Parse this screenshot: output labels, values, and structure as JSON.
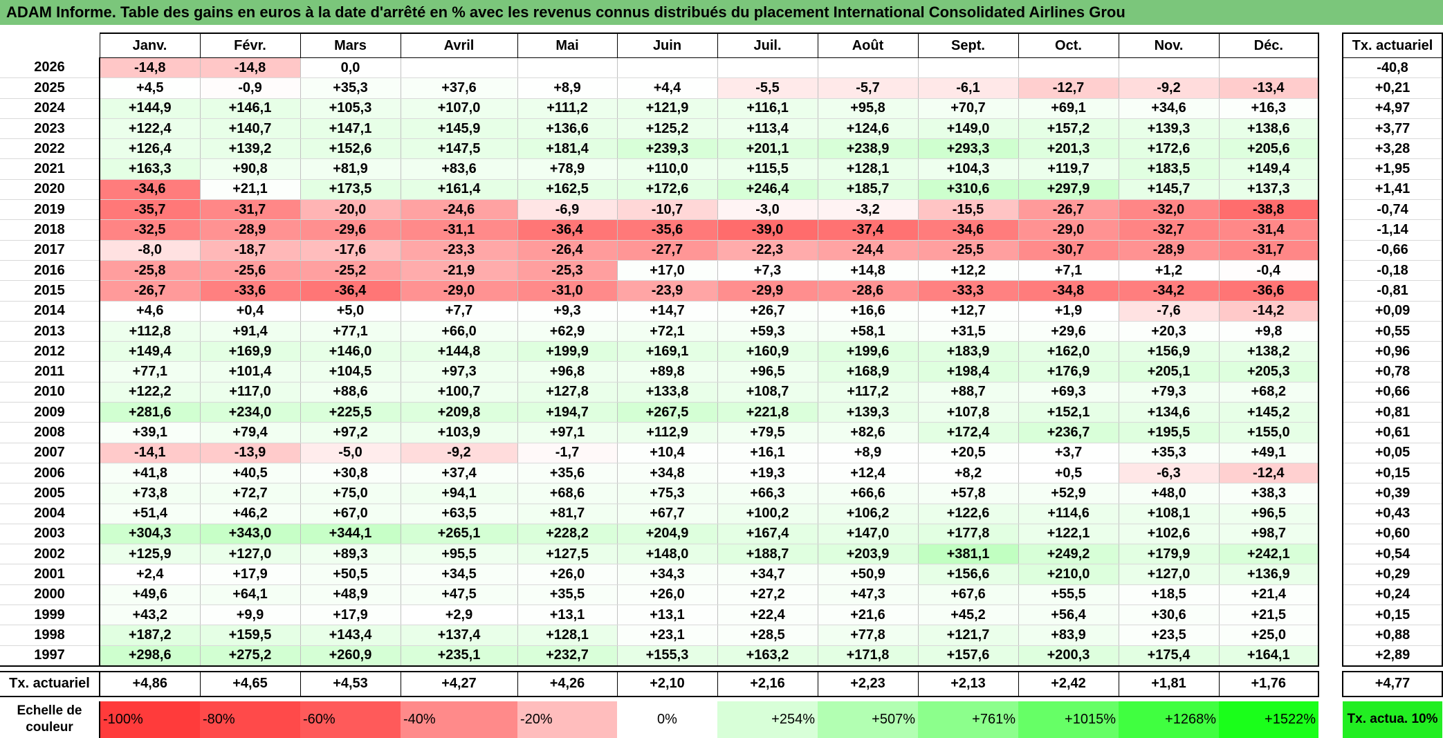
{
  "title": "ADAM Informe. Table des gains en euros à la date d'arrêté en % avec les revenus connus distribués du placement International Consolidated Airlines Grou",
  "months": [
    "Janv.",
    "Févr.",
    "Mars",
    "Avril",
    "Mai",
    "Juin",
    "Juil.",
    "Août",
    "Sept.",
    "Oct.",
    "Nov.",
    "Déc."
  ],
  "act_header": "Tx. actuariel",
  "rows": [
    {
      "year": "2026",
      "values": [
        "-14,8",
        "-14,8",
        "0,0",
        "",
        "",
        "",
        "",
        "",
        "",
        "",
        "",
        ""
      ],
      "act": "-40,8"
    },
    {
      "year": "2025",
      "values": [
        "+4,5",
        "-0,9",
        "+35,3",
        "+37,6",
        "+8,9",
        "+4,4",
        "-5,5",
        "-5,7",
        "-6,1",
        "-12,7",
        "-9,2",
        "-13,4"
      ],
      "act": "+0,21"
    },
    {
      "year": "2024",
      "values": [
        "+144,9",
        "+146,1",
        "+105,3",
        "+107,0",
        "+111,2",
        "+121,9",
        "+116,1",
        "+95,8",
        "+70,7",
        "+69,1",
        "+34,6",
        "+16,3"
      ],
      "act": "+4,97"
    },
    {
      "year": "2023",
      "values": [
        "+122,4",
        "+140,7",
        "+147,1",
        "+145,9",
        "+136,6",
        "+125,2",
        "+113,4",
        "+124,6",
        "+149,0",
        "+157,2",
        "+139,3",
        "+138,6"
      ],
      "act": "+3,77"
    },
    {
      "year": "2022",
      "values": [
        "+126,4",
        "+139,2",
        "+152,6",
        "+147,5",
        "+181,4",
        "+239,3",
        "+201,1",
        "+238,9",
        "+293,3",
        "+201,3",
        "+172,6",
        "+205,6"
      ],
      "act": "+3,28"
    },
    {
      "year": "2021",
      "values": [
        "+163,3",
        "+90,8",
        "+81,9",
        "+83,6",
        "+78,9",
        "+110,0",
        "+115,5",
        "+128,1",
        "+104,3",
        "+119,7",
        "+183,5",
        "+149,4"
      ],
      "act": "+1,95"
    },
    {
      "year": "2020",
      "values": [
        "-34,6",
        "+21,1",
        "+173,5",
        "+161,4",
        "+162,5",
        "+172,6",
        "+246,4",
        "+185,7",
        "+310,6",
        "+297,9",
        "+145,7",
        "+137,3"
      ],
      "act": "+1,41"
    },
    {
      "year": "2019",
      "values": [
        "-35,7",
        "-31,7",
        "-20,0",
        "-24,6",
        "-6,9",
        "-10,7",
        "-3,0",
        "-3,2",
        "-15,5",
        "-26,7",
        "-32,0",
        "-38,8"
      ],
      "act": "-0,74"
    },
    {
      "year": "2018",
      "values": [
        "-32,5",
        "-28,9",
        "-29,6",
        "-31,1",
        "-36,4",
        "-35,6",
        "-39,0",
        "-37,4",
        "-34,6",
        "-29,0",
        "-32,7",
        "-31,4"
      ],
      "act": "-1,14"
    },
    {
      "year": "2017",
      "values": [
        "-8,0",
        "-18,7",
        "-17,6",
        "-23,3",
        "-26,4",
        "-27,7",
        "-22,3",
        "-24,4",
        "-25,5",
        "-30,7",
        "-28,9",
        "-31,7"
      ],
      "act": "-0,66"
    },
    {
      "year": "2016",
      "values": [
        "-25,8",
        "-25,6",
        "-25,2",
        "-21,9",
        "-25,3",
        "+17,0",
        "+7,3",
        "+14,8",
        "+12,2",
        "+7,1",
        "+1,2",
        "-0,4"
      ],
      "act": "-0,18"
    },
    {
      "year": "2015",
      "values": [
        "-26,7",
        "-33,6",
        "-36,4",
        "-29,0",
        "-31,0",
        "-23,9",
        "-29,9",
        "-28,6",
        "-33,3",
        "-34,8",
        "-34,2",
        "-36,6"
      ],
      "act": "-0,81"
    },
    {
      "year": "2014",
      "values": [
        "+4,6",
        "+0,4",
        "+5,0",
        "+7,7",
        "+9,3",
        "+14,7",
        "+26,7",
        "+16,6",
        "+12,7",
        "+1,9",
        "-7,6",
        "-14,2"
      ],
      "act": "+0,09"
    },
    {
      "year": "2013",
      "values": [
        "+112,8",
        "+91,4",
        "+77,1",
        "+66,0",
        "+62,9",
        "+72,1",
        "+59,3",
        "+58,1",
        "+31,5",
        "+29,6",
        "+20,3",
        "+9,8"
      ],
      "act": "+0,55"
    },
    {
      "year": "2012",
      "values": [
        "+149,4",
        "+169,9",
        "+146,0",
        "+144,8",
        "+199,9",
        "+169,1",
        "+160,9",
        "+199,6",
        "+183,9",
        "+162,0",
        "+156,9",
        "+138,2"
      ],
      "act": "+0,96"
    },
    {
      "year": "2011",
      "values": [
        "+77,1",
        "+101,4",
        "+104,5",
        "+97,3",
        "+96,8",
        "+89,8",
        "+96,5",
        "+168,9",
        "+198,4",
        "+176,9",
        "+205,1",
        "+205,3"
      ],
      "act": "+0,78"
    },
    {
      "year": "2010",
      "values": [
        "+122,2",
        "+117,0",
        "+88,6",
        "+100,7",
        "+127,8",
        "+133,8",
        "+108,7",
        "+117,2",
        "+88,7",
        "+69,3",
        "+79,3",
        "+68,2"
      ],
      "act": "+0,66"
    },
    {
      "year": "2009",
      "values": [
        "+281,6",
        "+234,0",
        "+225,5",
        "+209,8",
        "+194,7",
        "+267,5",
        "+221,8",
        "+139,3",
        "+107,8",
        "+152,1",
        "+134,6",
        "+145,2"
      ],
      "act": "+0,81"
    },
    {
      "year": "2008",
      "values": [
        "+39,1",
        "+79,4",
        "+97,2",
        "+103,9",
        "+97,1",
        "+112,9",
        "+79,5",
        "+82,6",
        "+172,4",
        "+236,7",
        "+195,5",
        "+155,0"
      ],
      "act": "+0,61"
    },
    {
      "year": "2007",
      "values": [
        "-14,1",
        "-13,9",
        "-5,0",
        "-9,2",
        "-1,7",
        "+10,4",
        "+16,1",
        "+8,9",
        "+20,5",
        "+3,7",
        "+35,3",
        "+49,1"
      ],
      "act": "+0,05"
    },
    {
      "year": "2006",
      "values": [
        "+41,8",
        "+40,5",
        "+30,8",
        "+37,4",
        "+35,6",
        "+34,8",
        "+19,3",
        "+12,4",
        "+8,2",
        "+0,5",
        "-6,3",
        "-12,4"
      ],
      "act": "+0,15"
    },
    {
      "year": "2005",
      "values": [
        "+73,8",
        "+72,7",
        "+75,0",
        "+94,1",
        "+68,6",
        "+75,3",
        "+66,3",
        "+66,6",
        "+57,8",
        "+52,9",
        "+48,0",
        "+38,3"
      ],
      "act": "+0,39"
    },
    {
      "year": "2004",
      "values": [
        "+51,4",
        "+46,2",
        "+67,0",
        "+63,5",
        "+81,7",
        "+67,7",
        "+100,2",
        "+106,2",
        "+122,6",
        "+114,6",
        "+108,1",
        "+96,5"
      ],
      "act": "+0,43"
    },
    {
      "year": "2003",
      "values": [
        "+304,3",
        "+343,0",
        "+344,1",
        "+265,1",
        "+228,2",
        "+204,9",
        "+167,4",
        "+147,0",
        "+177,8",
        "+122,1",
        "+102,6",
        "+98,7"
      ],
      "act": "+0,60"
    },
    {
      "year": "2002",
      "values": [
        "+125,9",
        "+127,0",
        "+89,3",
        "+95,5",
        "+127,5",
        "+148,0",
        "+188,7",
        "+203,9",
        "+381,1",
        "+249,2",
        "+179,9",
        "+242,1"
      ],
      "act": "+0,54"
    },
    {
      "year": "2001",
      "values": [
        "+2,4",
        "+17,9",
        "+50,5",
        "+34,5",
        "+26,0",
        "+34,3",
        "+34,7",
        "+50,9",
        "+156,6",
        "+210,0",
        "+127,0",
        "+136,9"
      ],
      "act": "+0,29"
    },
    {
      "year": "2000",
      "values": [
        "+49,6",
        "+64,1",
        "+48,9",
        "+47,5",
        "+35,5",
        "+26,0",
        "+27,2",
        "+47,3",
        "+67,6",
        "+55,5",
        "+18,5",
        "+21,4"
      ],
      "act": "+0,24"
    },
    {
      "year": "1999",
      "values": [
        "+43,2",
        "+9,9",
        "+17,9",
        "+2,9",
        "+13,1",
        "+13,1",
        "+22,4",
        "+21,6",
        "+45,2",
        "+56,4",
        "+30,6",
        "+21,5"
      ],
      "act": "+0,15"
    },
    {
      "year": "1998",
      "values": [
        "+187,2",
        "+159,5",
        "+143,4",
        "+137,4",
        "+128,1",
        "+23,1",
        "+28,5",
        "+77,8",
        "+121,7",
        "+83,9",
        "+23,5",
        "+25,0"
      ],
      "act": "+0,88"
    },
    {
      "year": "1997",
      "values": [
        "+298,6",
        "+275,2",
        "+260,9",
        "+235,1",
        "+232,7",
        "+155,3",
        "+163,2",
        "+171,8",
        "+157,6",
        "+200,3",
        "+175,4",
        "+164,1"
      ],
      "act": "+2,89"
    }
  ],
  "act_row": {
    "label": "Tx. actuariel",
    "values": [
      "+4,86",
      "+4,65",
      "+4,53",
      "+4,27",
      "+4,26",
      "+2,10",
      "+2,16",
      "+2,23",
      "+2,13",
      "+2,42",
      "+1,81",
      "+1,76"
    ],
    "total": "+4,77"
  },
  "scale": {
    "label": "Echelle de couleur",
    "items": [
      {
        "label": "-100%",
        "color": "#ff3b3b"
      },
      {
        "label": "-80%",
        "color": "#ff4a4a"
      },
      {
        "label": "-60%",
        "color": "#ff5a5a"
      },
      {
        "label": "-40%",
        "color": "#ff8a8a"
      },
      {
        "label": "-20%",
        "color": "#ffbdbd"
      },
      {
        "label": "0%",
        "color": "#ffffff"
      },
      {
        "label": "+254%",
        "color": "#d8ffd8"
      },
      {
        "label": "+507%",
        "color": "#b2ffb2"
      },
      {
        "label": "+761%",
        "color": "#8cff8c"
      },
      {
        "label": "+1015%",
        "color": "#66ff66"
      },
      {
        "label": "+1268%",
        "color": "#40ff40"
      },
      {
        "label": "+1522%",
        "color": "#1aff1a"
      }
    ],
    "act_label": "Tx. actua. 10%",
    "act_color": "#22ee22"
  },
  "colors": {
    "title_bg": "#7bc67b",
    "neg_max": "#ff4a4a",
    "pos_max": "#1aff1a"
  }
}
